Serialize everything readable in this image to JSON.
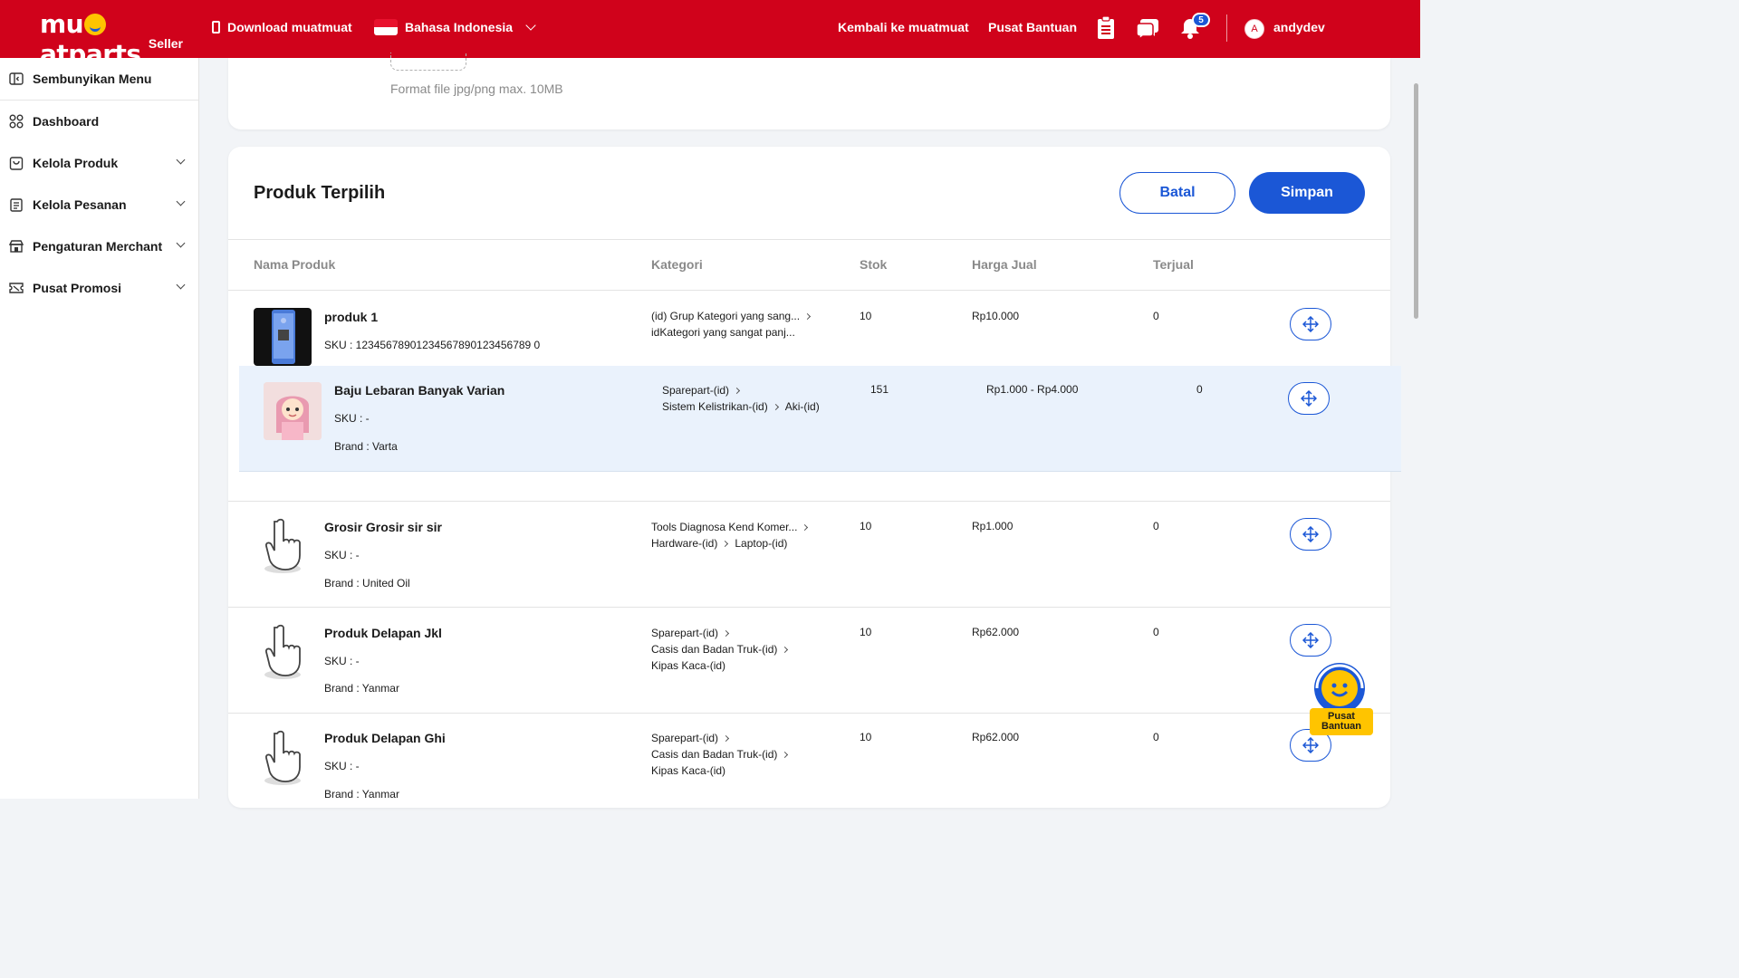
{
  "header": {
    "brand": "mu",
    "brand_rest": "atparts",
    "brand_sub": "Seller",
    "download": "Download muatmuat",
    "language": "Bahasa Indonesia",
    "back": "Kembali ke muatmuat",
    "help": "Pusat Bantuan",
    "notif_count": "5",
    "avatar_initial": "A",
    "username": "andydev",
    "colors": {
      "primary": "#d0021b",
      "accent": "#1b57d6"
    }
  },
  "sidebar": {
    "items": [
      {
        "label": "Sembunyikan Menu",
        "icon": "sidebar-collapse-icon"
      },
      {
        "label": "Dashboard",
        "icon": "grid-icon"
      },
      {
        "label": "Kelola Produk",
        "icon": "bag-icon"
      },
      {
        "label": "Kelola Pesanan",
        "icon": "clipboard-icon"
      },
      {
        "label": "Pengaturan Merchant",
        "icon": "store-icon"
      },
      {
        "label": "Pusat Promosi",
        "icon": "ticket-icon"
      }
    ]
  },
  "upload": {
    "hint": "Format file jpg/png max. 10MB"
  },
  "selected": {
    "title": "Produk Terpilih",
    "cancel": "Batal",
    "save": "Simpan",
    "columns": [
      "Nama Produk",
      "Kategori",
      "Stok",
      "Harga Jual",
      "Terjual"
    ],
    "rows": [
      {
        "name": "produk 1",
        "sku": "SKU : 12345678901234567890123456789 0",
        "cat1": "(id) Grup Kategori yang sang...",
        "cat2": "idKategori yang sangat panj...",
        "stock": "10",
        "price": "Rp10.000",
        "sold": "0"
      },
      {
        "name": "Baju Lebaran Banyak Varian",
        "sku": "SKU : -",
        "brand": "Brand : Varta",
        "cat1": "Sparepart-(id)",
        "cat2a": "Sistem Kelistrikan-(id)",
        "cat2b": "Aki-(id)",
        "stock": "151",
        "price": "Rp1.000 - Rp4.000",
        "sold": "0"
      },
      {
        "name": "Grosir Grosir sir sir",
        "sku": "SKU : -",
        "brand": "Brand : United Oil",
        "cat1": "Tools Diagnosa Kend Komer...",
        "cat2a": "Hardware-(id)",
        "cat2b": "Laptop-(id)",
        "stock": "10",
        "price": "Rp1.000",
        "sold": "0"
      },
      {
        "name": "Produk Delapan Jkl",
        "sku": "SKU : -",
        "brand": "Brand : Yanmar",
        "cat1": "Sparepart-(id)",
        "cat2": "Casis dan Badan Truk-(id)",
        "cat3": "Kipas Kaca-(id)",
        "stock": "10",
        "price": "Rp62.000",
        "sold": "0"
      },
      {
        "name": "Produk Delapan Ghi",
        "sku": "SKU : -",
        "brand": "Brand : Yanmar",
        "cat1": "Sparepart-(id)",
        "cat2": "Casis dan Badan Truk-(id)",
        "cat3": "Kipas Kaca-(id)",
        "stock": "10",
        "price": "Rp62.000",
        "sold": "0"
      }
    ]
  },
  "help_float": {
    "line1": "Pusat",
    "line2": "Bantuan"
  }
}
